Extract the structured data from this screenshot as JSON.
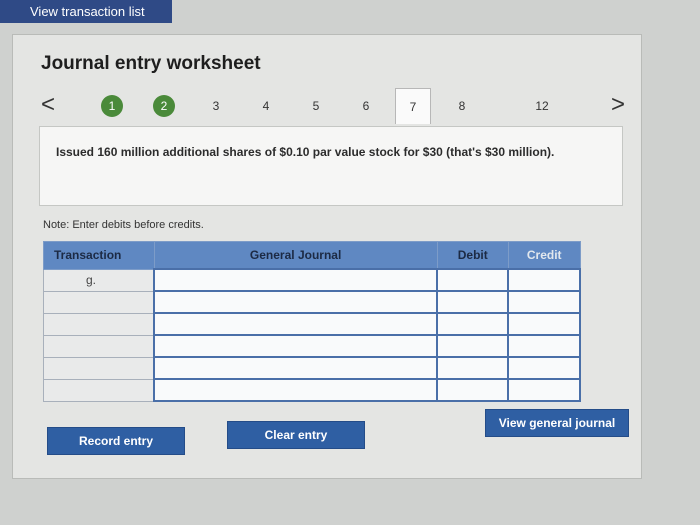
{
  "top_button": "View transaction list",
  "title": "Journal entry worksheet",
  "nav": {
    "prev_arrow": "<",
    "next_arrow": ">",
    "items": [
      "1",
      "2",
      "3",
      "4",
      "5",
      "6",
      "7",
      "8",
      "12"
    ],
    "completed": [
      "1",
      "2"
    ],
    "active": "7"
  },
  "question": "Issued 160 million additional shares of $0.10 par value stock for $30 (that's $30 million).",
  "note": "Note: Enter debits before credits.",
  "table": {
    "headers": {
      "transaction": "Transaction",
      "general_journal": "General Journal",
      "debit": "Debit",
      "credit": "Credit"
    },
    "rows": [
      {
        "transaction": "g.",
        "account": "",
        "debit": "",
        "credit": ""
      },
      {
        "transaction": "",
        "account": "",
        "debit": "",
        "credit": ""
      },
      {
        "transaction": "",
        "account": "",
        "debit": "",
        "credit": ""
      },
      {
        "transaction": "",
        "account": "",
        "debit": "",
        "credit": ""
      },
      {
        "transaction": "",
        "account": "",
        "debit": "",
        "credit": ""
      },
      {
        "transaction": "",
        "account": "",
        "debit": "",
        "credit": ""
      }
    ]
  },
  "buttons": {
    "record_entry": "Record entry",
    "clear_entry": "Clear entry",
    "view_general_journal": "View general journal"
  },
  "colors": {
    "accent": "#2f5fa3",
    "completed_step": "#4a8a3a",
    "table_header": "#5f88c2"
  }
}
